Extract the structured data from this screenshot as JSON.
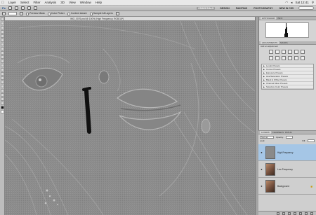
{
  "menubar": {
    "items": [
      "Layer",
      "Select",
      "Filter",
      "Analysis",
      "3D",
      "View",
      "Window",
      "Help"
    ],
    "clock": "Sat 12:41"
  },
  "appbar": {
    "workspaces": [
      "ESSENTIALS",
      "DESIGN",
      "PAINTING"
    ],
    "active_workspace": "ESSENTIALS",
    "right_labels": [
      "PHOTOGRAPHY",
      "NEW IN CS5"
    ]
  },
  "options": {
    "items": [
      "Preview Mask",
      "Color Picker",
      "Content Aware",
      "Sample All Layers"
    ]
  },
  "document": {
    "tab_title": "IMG_0076.psd @ 100% (High Frequency, RGB/16*)"
  },
  "panels": {
    "histogram_tabs": [
      "HISTOGRAM",
      "INFO"
    ],
    "adjust_tabs": [
      "ADJUSTMENTS",
      "MASKS"
    ],
    "adjust_title": "Add an adjustment",
    "presets": [
      "Levels Presets",
      "Curves Presets",
      "Exposure Presets",
      "Hue/Saturation Presets",
      "Black & White Presets",
      "Channel Mixer Presets",
      "Selective Color Presets"
    ]
  },
  "layers": {
    "tabs": [
      "LAYERS",
      "CHANNELS",
      "PATHS"
    ],
    "blend_mode": "Normal",
    "opacity_label": "Opacity:",
    "lock_label": "Lock:",
    "fill_label": "Fill:",
    "items": [
      {
        "name": "High Frequency",
        "selected": true
      },
      {
        "name": "Low Frequency",
        "selected": false
      },
      {
        "name": "Background",
        "selected": false
      }
    ]
  },
  "colors": {
    "canvas_gray": "#888888",
    "selection_blue": "#a5c6e6"
  }
}
